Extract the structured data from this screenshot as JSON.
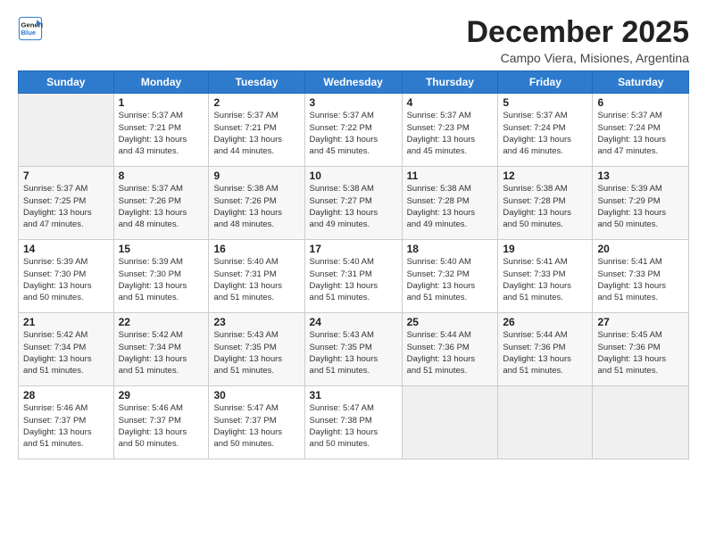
{
  "logo": {
    "line1": "General",
    "line2": "Blue"
  },
  "title": "December 2025",
  "subtitle": "Campo Viera, Misiones, Argentina",
  "days_header": [
    "Sunday",
    "Monday",
    "Tuesday",
    "Wednesday",
    "Thursday",
    "Friday",
    "Saturday"
  ],
  "weeks": [
    [
      {
        "day": "",
        "info": ""
      },
      {
        "day": "1",
        "info": "Sunrise: 5:37 AM\nSunset: 7:21 PM\nDaylight: 13 hours\nand 43 minutes."
      },
      {
        "day": "2",
        "info": "Sunrise: 5:37 AM\nSunset: 7:21 PM\nDaylight: 13 hours\nand 44 minutes."
      },
      {
        "day": "3",
        "info": "Sunrise: 5:37 AM\nSunset: 7:22 PM\nDaylight: 13 hours\nand 45 minutes."
      },
      {
        "day": "4",
        "info": "Sunrise: 5:37 AM\nSunset: 7:23 PM\nDaylight: 13 hours\nand 45 minutes."
      },
      {
        "day": "5",
        "info": "Sunrise: 5:37 AM\nSunset: 7:24 PM\nDaylight: 13 hours\nand 46 minutes."
      },
      {
        "day": "6",
        "info": "Sunrise: 5:37 AM\nSunset: 7:24 PM\nDaylight: 13 hours\nand 47 minutes."
      }
    ],
    [
      {
        "day": "7",
        "info": "Sunrise: 5:37 AM\nSunset: 7:25 PM\nDaylight: 13 hours\nand 47 minutes."
      },
      {
        "day": "8",
        "info": "Sunrise: 5:37 AM\nSunset: 7:26 PM\nDaylight: 13 hours\nand 48 minutes."
      },
      {
        "day": "9",
        "info": "Sunrise: 5:38 AM\nSunset: 7:26 PM\nDaylight: 13 hours\nand 48 minutes."
      },
      {
        "day": "10",
        "info": "Sunrise: 5:38 AM\nSunset: 7:27 PM\nDaylight: 13 hours\nand 49 minutes."
      },
      {
        "day": "11",
        "info": "Sunrise: 5:38 AM\nSunset: 7:28 PM\nDaylight: 13 hours\nand 49 minutes."
      },
      {
        "day": "12",
        "info": "Sunrise: 5:38 AM\nSunset: 7:28 PM\nDaylight: 13 hours\nand 50 minutes."
      },
      {
        "day": "13",
        "info": "Sunrise: 5:39 AM\nSunset: 7:29 PM\nDaylight: 13 hours\nand 50 minutes."
      }
    ],
    [
      {
        "day": "14",
        "info": "Sunrise: 5:39 AM\nSunset: 7:30 PM\nDaylight: 13 hours\nand 50 minutes."
      },
      {
        "day": "15",
        "info": "Sunrise: 5:39 AM\nSunset: 7:30 PM\nDaylight: 13 hours\nand 51 minutes."
      },
      {
        "day": "16",
        "info": "Sunrise: 5:40 AM\nSunset: 7:31 PM\nDaylight: 13 hours\nand 51 minutes."
      },
      {
        "day": "17",
        "info": "Sunrise: 5:40 AM\nSunset: 7:31 PM\nDaylight: 13 hours\nand 51 minutes."
      },
      {
        "day": "18",
        "info": "Sunrise: 5:40 AM\nSunset: 7:32 PM\nDaylight: 13 hours\nand 51 minutes."
      },
      {
        "day": "19",
        "info": "Sunrise: 5:41 AM\nSunset: 7:33 PM\nDaylight: 13 hours\nand 51 minutes."
      },
      {
        "day": "20",
        "info": "Sunrise: 5:41 AM\nSunset: 7:33 PM\nDaylight: 13 hours\nand 51 minutes."
      }
    ],
    [
      {
        "day": "21",
        "info": "Sunrise: 5:42 AM\nSunset: 7:34 PM\nDaylight: 13 hours\nand 51 minutes."
      },
      {
        "day": "22",
        "info": "Sunrise: 5:42 AM\nSunset: 7:34 PM\nDaylight: 13 hours\nand 51 minutes."
      },
      {
        "day": "23",
        "info": "Sunrise: 5:43 AM\nSunset: 7:35 PM\nDaylight: 13 hours\nand 51 minutes."
      },
      {
        "day": "24",
        "info": "Sunrise: 5:43 AM\nSunset: 7:35 PM\nDaylight: 13 hours\nand 51 minutes."
      },
      {
        "day": "25",
        "info": "Sunrise: 5:44 AM\nSunset: 7:36 PM\nDaylight: 13 hours\nand 51 minutes."
      },
      {
        "day": "26",
        "info": "Sunrise: 5:44 AM\nSunset: 7:36 PM\nDaylight: 13 hours\nand 51 minutes."
      },
      {
        "day": "27",
        "info": "Sunrise: 5:45 AM\nSunset: 7:36 PM\nDaylight: 13 hours\nand 51 minutes."
      }
    ],
    [
      {
        "day": "28",
        "info": "Sunrise: 5:46 AM\nSunset: 7:37 PM\nDaylight: 13 hours\nand 51 minutes."
      },
      {
        "day": "29",
        "info": "Sunrise: 5:46 AM\nSunset: 7:37 PM\nDaylight: 13 hours\nand 50 minutes."
      },
      {
        "day": "30",
        "info": "Sunrise: 5:47 AM\nSunset: 7:37 PM\nDaylight: 13 hours\nand 50 minutes."
      },
      {
        "day": "31",
        "info": "Sunrise: 5:47 AM\nSunset: 7:38 PM\nDaylight: 13 hours\nand 50 minutes."
      },
      {
        "day": "",
        "info": ""
      },
      {
        "day": "",
        "info": ""
      },
      {
        "day": "",
        "info": ""
      }
    ]
  ]
}
